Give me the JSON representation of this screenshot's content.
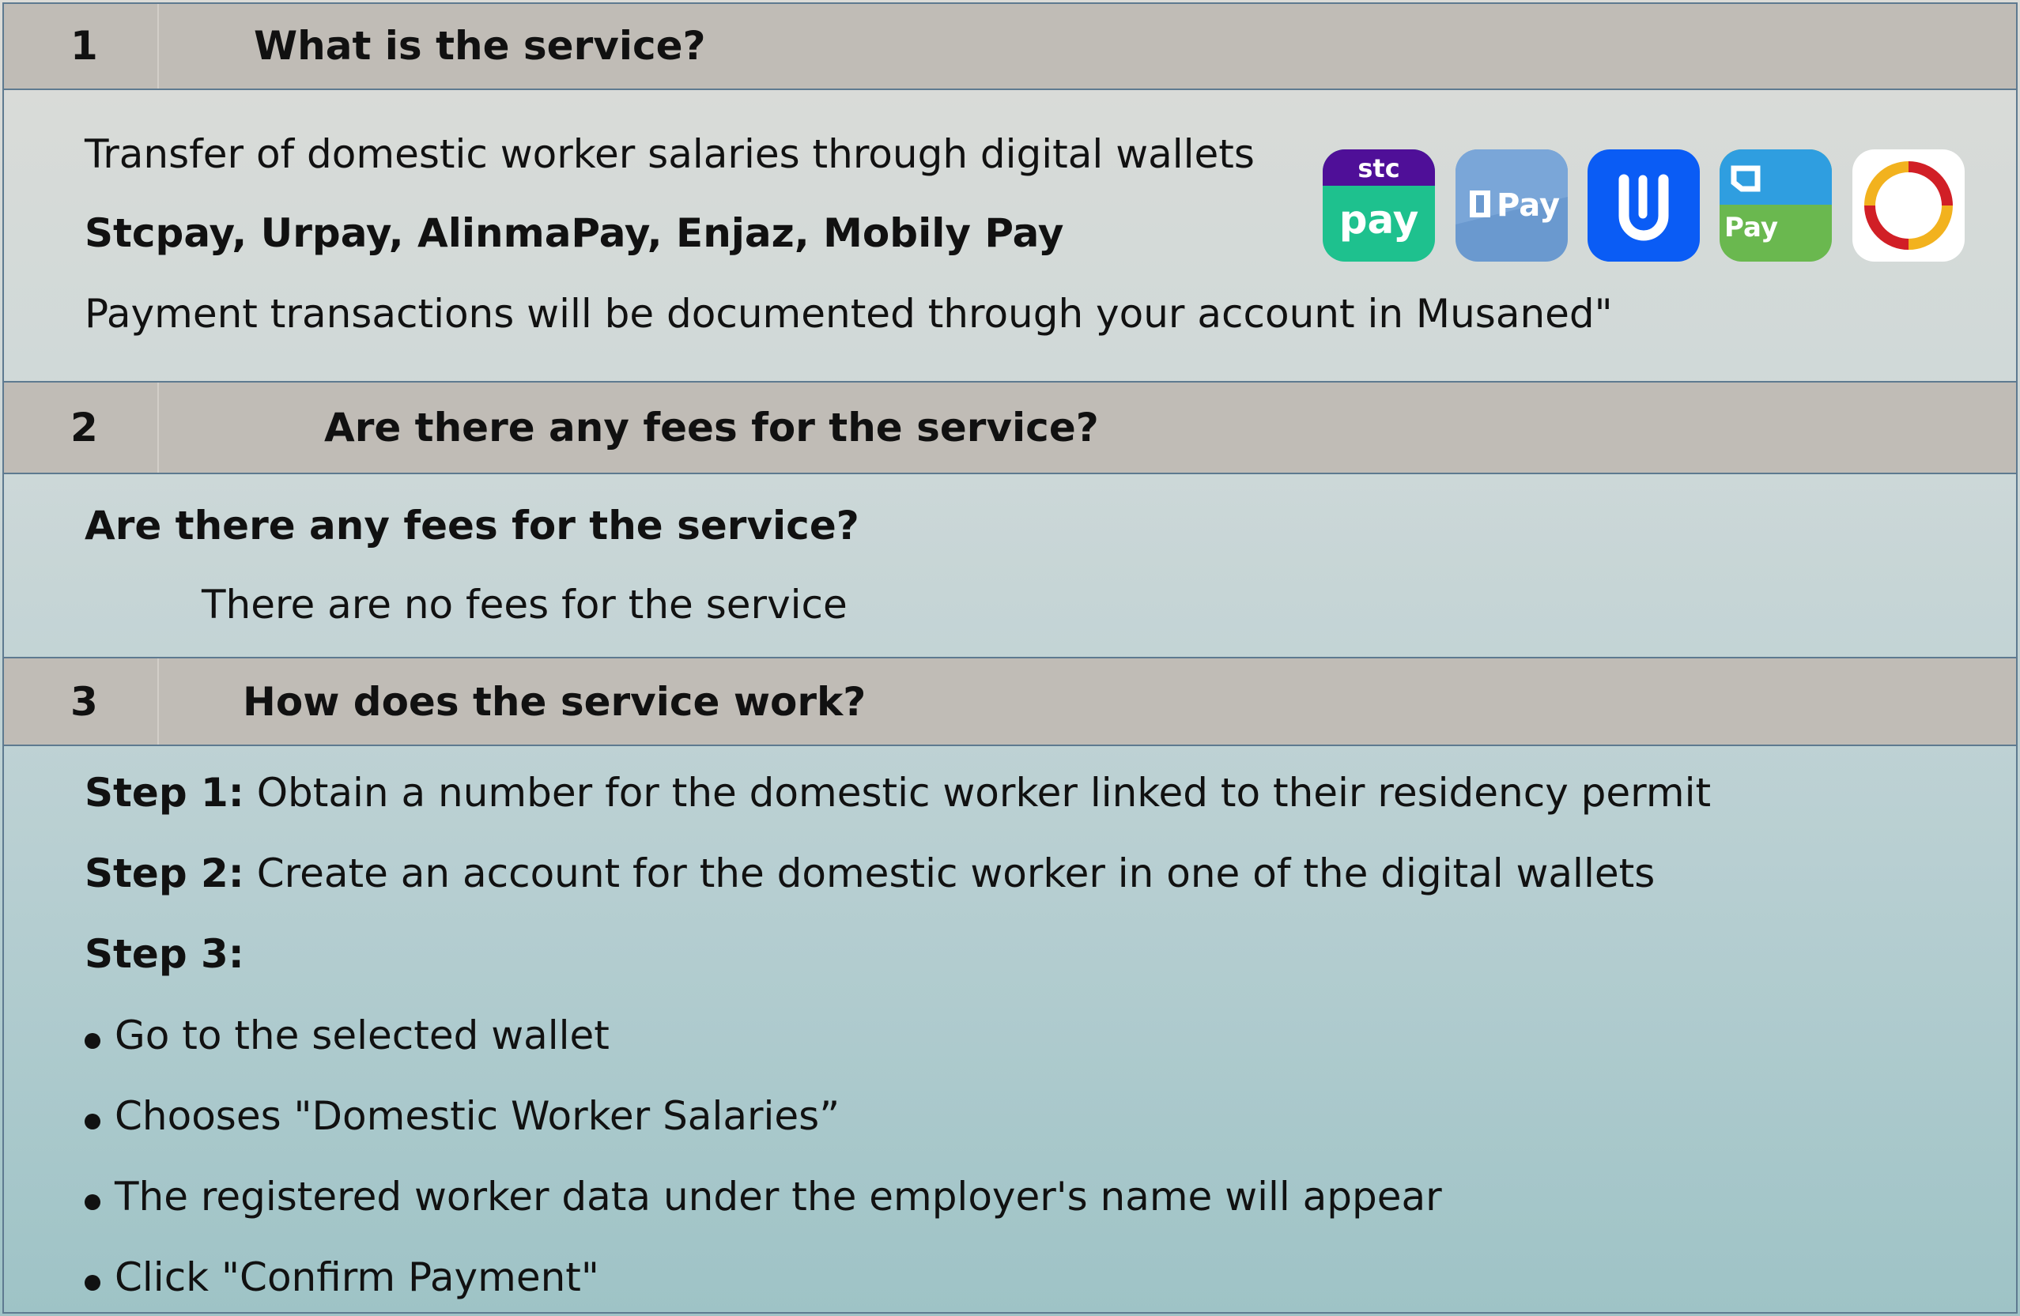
{
  "sections": [
    {
      "num": "1",
      "question": "What is the service?",
      "lines": [
        "Transfer of domestic worker salaries through digital wallets",
        "Stcpay, Urpay, AlinmaPay, Enjaz, Mobily Pay",
        "Payment transactions will be documented through your account in Musaned\""
      ]
    },
    {
      "num": "2",
      "question": "Are there any fees for the service?",
      "lines": [
        "Are there any fees for the service?",
        "There are no fees for the service"
      ]
    },
    {
      "num": "3",
      "question": "How does the service work?",
      "steps": [
        {
          "label": "Step 1:",
          "text": " Obtain a number for the domestic worker linked to their residency permit"
        },
        {
          "label": "Step 2:",
          "text": " Create an account for the domestic worker in one of the digital wallets"
        },
        {
          "label": "Step 3:",
          "text": ""
        }
      ],
      "bullets": [
        "Go to the selected wallet",
        "Chooses \"Domestic Worker Salaries”",
        "The registered worker data under the employer's name will appear",
        "Click \"Confirm Payment\""
      ]
    }
  ],
  "logos": {
    "stc_top": "stc",
    "stc_bottom": "pay",
    "urpay": "Pay",
    "mobily": "Pay"
  },
  "colors": {
    "header_bg": "#c0bcb6",
    "border": "#5e7a90",
    "stc_purple": "#4f0f98",
    "stc_green": "#1ec18e",
    "urpay_blue": "#6a99cf",
    "alinma_blue": "#0a5cf5",
    "mobily_blue": "#2f9ee0",
    "mobily_green": "#6ab84f",
    "enjaz_red": "#d11f26",
    "enjaz_yellow": "#f2b21e"
  }
}
